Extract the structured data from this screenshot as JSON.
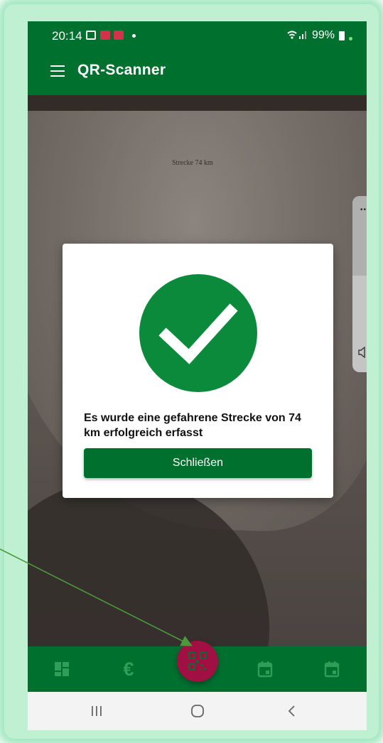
{
  "status_bar": {
    "time": "20:14",
    "battery": "99%"
  },
  "app_bar": {
    "title": "QR-Scanner",
    "menu_icon": "hamburger-menu-icon"
  },
  "camera": {
    "paper_text": "Strecke 74 km"
  },
  "dialog": {
    "icon": "check-circle-icon",
    "message": "Es wurde eine gefahrene Strecke von 74 km erfolgreich erfasst",
    "close_label": "Schließen"
  },
  "bottom_nav": {
    "items": [
      {
        "icon": "dashboard-icon"
      },
      {
        "icon": "euro-icon",
        "glyph": "€"
      },
      {
        "icon": "qr-scanner-icon",
        "active": true
      },
      {
        "icon": "calendar-icon"
      },
      {
        "icon": "calendar-icon"
      }
    ]
  },
  "system_nav": [
    "recent-apps-icon",
    "home-icon",
    "back-icon"
  ],
  "colors": {
    "primary": "#00702f",
    "success": "#0b8a3c",
    "fab": "#a11042",
    "annotation_arrow": "#4a9a3c"
  }
}
